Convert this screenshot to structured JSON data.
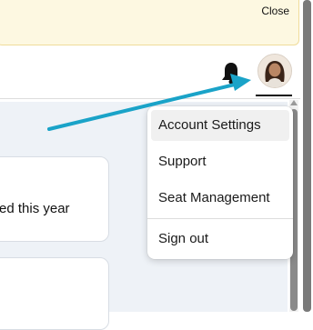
{
  "banner": {
    "close_label": "Close"
  },
  "header": {
    "notification_icon": "bell-icon",
    "avatar_icon": "user-avatar"
  },
  "content": {
    "card_text": "ed this year"
  },
  "account_menu": {
    "items": [
      {
        "label": "Account Settings",
        "active": true
      },
      {
        "label": "Support",
        "active": false
      },
      {
        "label": "Seat Management",
        "active": false
      },
      {
        "label": "Sign out",
        "active": false
      }
    ]
  },
  "annotation": {
    "arrow_color": "#1aa3c8"
  }
}
